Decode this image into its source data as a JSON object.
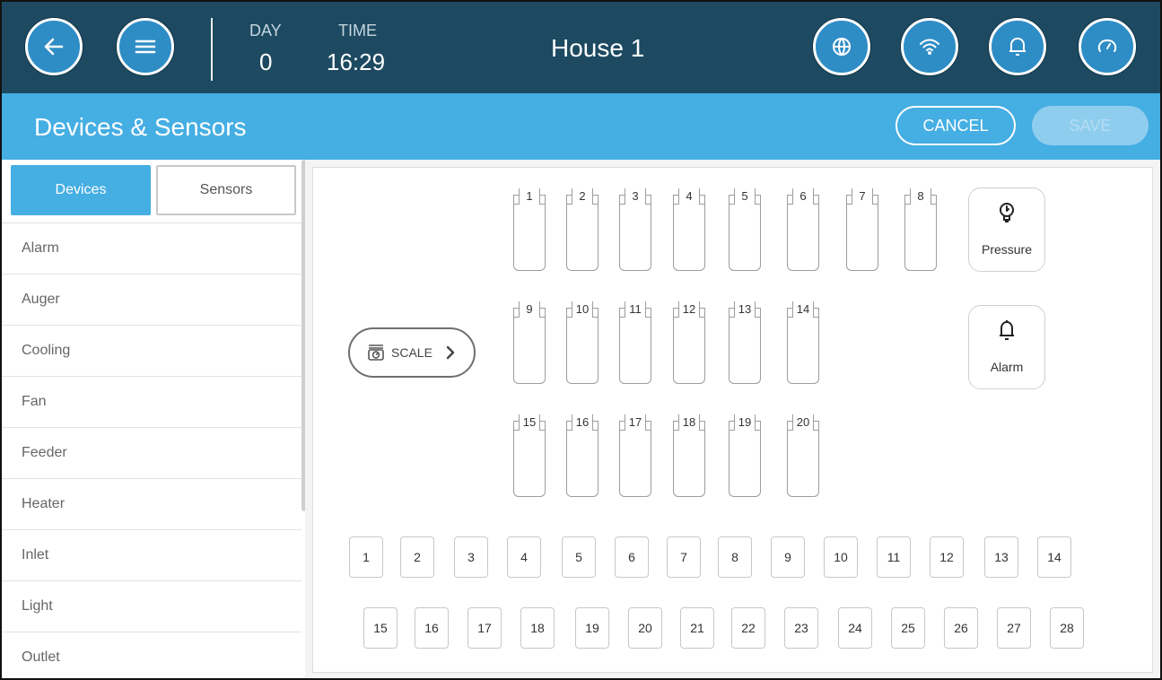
{
  "header": {
    "back_icon": "arrow-left-icon",
    "menu_icon": "hamburger-menu-icon",
    "day_label": "DAY",
    "day_value": "0",
    "time_label": "TIME",
    "time_value": "16:29",
    "house_name": "House 1",
    "right_icons": [
      "globe-icon",
      "wifi-icon",
      "bell-icon",
      "gauge-icon"
    ]
  },
  "subheader": {
    "title": "Devices & Sensors",
    "cancel_label": "CANCEL",
    "save_label": "SAVE"
  },
  "sidebar": {
    "tabs": [
      {
        "label": "Devices",
        "active": true
      },
      {
        "label": "Sensors",
        "active": false
      }
    ],
    "items": [
      {
        "label": "Alarm"
      },
      {
        "label": "Auger"
      },
      {
        "label": "Cooling"
      },
      {
        "label": "Fan"
      },
      {
        "label": "Feeder"
      },
      {
        "label": "Heater"
      },
      {
        "label": "Inlet"
      },
      {
        "label": "Light"
      },
      {
        "label": "Outlet"
      }
    ]
  },
  "main": {
    "slot_rows": [
      [
        "1",
        "2",
        "3",
        "4",
        "5",
        "6",
        "7",
        "8"
      ],
      [
        "9",
        "10",
        "11",
        "12",
        "13",
        "14"
      ],
      [
        "15",
        "16",
        "17",
        "18",
        "19",
        "20"
      ]
    ],
    "cards": [
      {
        "label": "Pressure",
        "icon": "pressure-sensor-icon"
      },
      {
        "label": "Alarm",
        "icon": "bell-icon"
      }
    ],
    "scale": {
      "label": "SCALE",
      "icon": "scale-icon"
    },
    "chip_rows": [
      [
        "1",
        "2",
        "3",
        "4",
        "5",
        "6",
        "7",
        "8",
        "9",
        "10",
        "11",
        "12",
        "13",
        "14"
      ],
      [
        "15",
        "16",
        "17",
        "18",
        "19",
        "20",
        "21",
        "22",
        "23",
        "24",
        "25",
        "26",
        "27",
        "28"
      ]
    ]
  },
  "colors": {
    "top_bar": "#1d4a61",
    "accent_blue": "#45aee3",
    "round_button": "#2f8dc6"
  }
}
